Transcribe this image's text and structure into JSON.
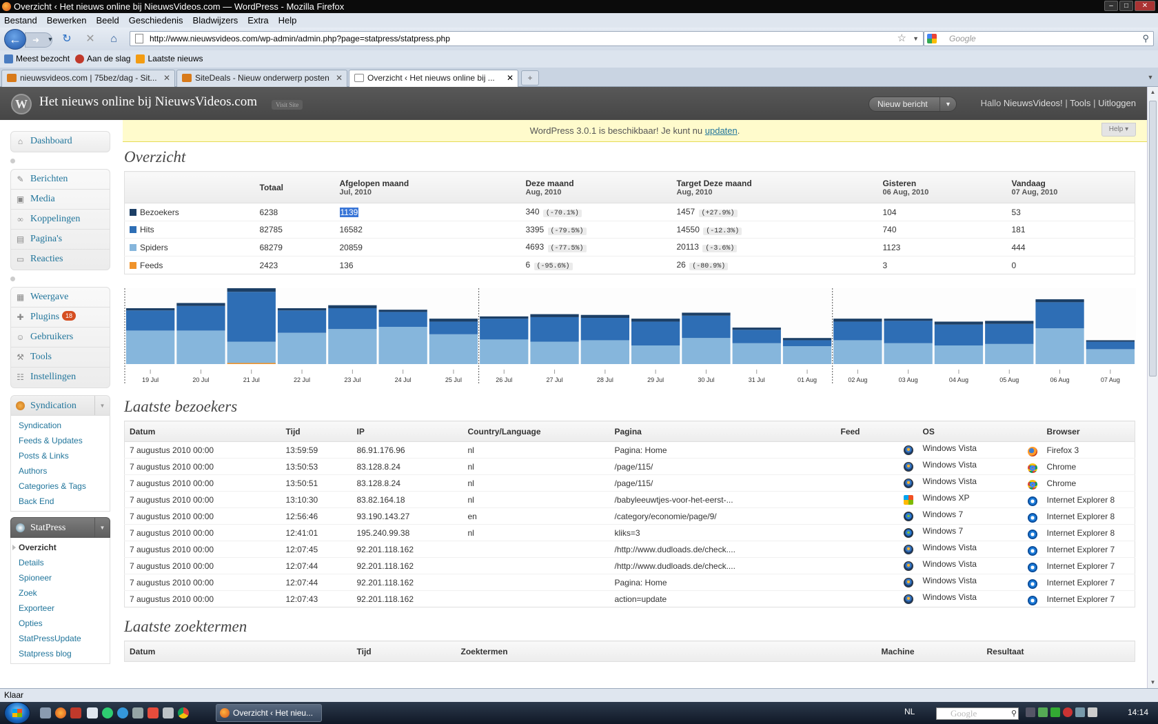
{
  "window": {
    "title": "Overzicht ‹ Het nieuws online bij NieuwsVideos.com — WordPress - Mozilla Firefox"
  },
  "menubar": [
    "Bestand",
    "Bewerken",
    "Beeld",
    "Geschiedenis",
    "Bladwijzers",
    "Extra",
    "Help"
  ],
  "url": "http://www.nieuwsvideos.com/wp-admin/admin.php?page=statpress/statpress.php",
  "search_placeholder": "Google",
  "bookmarks": [
    "Meest bezocht",
    "Aan de slag",
    "Laatste nieuws"
  ],
  "tabs": [
    {
      "label": "nieuwsvideos.com | 75bez/dag - Sit...",
      "active": false
    },
    {
      "label": "SiteDeals - Nieuw onderwerp posten",
      "active": false
    },
    {
      "label": "Overzicht ‹ Het nieuws online bij ...",
      "active": true
    }
  ],
  "wp": {
    "site_title": "Het nieuws online bij NieuwsVideos.com",
    "visit_site": "Visit Site",
    "new_post": "Nieuw bericht",
    "greeting": "Hallo",
    "username": "NieuwsVideos!",
    "tools": "Tools",
    "logout": "Uitloggen",
    "update_text": "WordPress 3.0.1 is beschikbaar! Je kunt nu",
    "update_link": "updaten",
    "update_end": ".",
    "help": "Help"
  },
  "sidebar": {
    "dashboard": "Dashboard",
    "content_items": [
      "Berichten",
      "Media",
      "Koppelingen",
      "Pagina's",
      "Reacties"
    ],
    "admin_items": [
      "Weergave",
      "Plugins",
      "Gebruikers",
      "Tools",
      "Instellingen"
    ],
    "plugins_badge": "18",
    "syndication": {
      "title": "Syndication",
      "items": [
        "Syndication",
        "Feeds & Updates",
        "Posts & Links",
        "Authors",
        "Categories & Tags",
        "Back End"
      ]
    },
    "statpress": {
      "title": "StatPress",
      "items": [
        "Overzicht",
        "Details",
        "Spioneer",
        "Zoek",
        "Exporteer",
        "Opties",
        "StatPressUpdate",
        "Statpress blog"
      ]
    }
  },
  "overview": {
    "heading": "Overzicht",
    "columns": [
      {
        "label": "",
        "sub": ""
      },
      {
        "label": "Totaal",
        "sub": ""
      },
      {
        "label": "Afgelopen maand",
        "sub": "Jul, 2010"
      },
      {
        "label": "Deze maand",
        "sub": "Aug, 2010"
      },
      {
        "label": "Target Deze maand",
        "sub": "Aug, 2010"
      },
      {
        "label": "Gisteren",
        "sub": "06 Aug, 2010"
      },
      {
        "label": "Vandaag",
        "sub": "07 Aug, 2010"
      }
    ],
    "rows": [
      {
        "name": "Bezoekers",
        "color": "#1c3f66",
        "totaal": "6238",
        "afgelopen": "1139",
        "deze": "340",
        "deze_pct": "(-70.1%)",
        "target": "1457",
        "target_pct": "(+27.9%)",
        "gisteren": "104",
        "vandaag": "53"
      },
      {
        "name": "Hits",
        "color": "#2e6eb5",
        "totaal": "82785",
        "afgelopen": "16582",
        "deze": "3395",
        "deze_pct": "(-79.5%)",
        "target": "14550",
        "target_pct": "(-12.3%)",
        "gisteren": "740",
        "vandaag": "181"
      },
      {
        "name": "Spiders",
        "color": "#86b6dc",
        "totaal": "68279",
        "afgelopen": "20859",
        "deze": "4693",
        "deze_pct": "(-77.5%)",
        "target": "20113",
        "target_pct": "(-3.6%)",
        "gisteren": "1123",
        "vandaag": "444"
      },
      {
        "name": "Feeds",
        "color": "#f0932b",
        "totaal": "2423",
        "afgelopen": "136",
        "deze": "6",
        "deze_pct": "(-95.6%)",
        "target": "26",
        "target_pct": "(-80.9%)",
        "gisteren": "3",
        "vandaag": "0"
      }
    ]
  },
  "chart_data": {
    "type": "bar",
    "categories": [
      "19 Jul",
      "20 Jul",
      "21 Jul",
      "22 Jul",
      "23 Jul",
      "24 Jul",
      "25 Jul",
      "26 Jul",
      "27 Jul",
      "28 Jul",
      "29 Jul",
      "30 Jul",
      "31 Jul",
      "01 Aug",
      "02 Aug",
      "03 Aug",
      "04 Aug",
      "05 Aug",
      "06 Aug",
      "07 Aug"
    ],
    "series": [
      {
        "name": "Spiders",
        "color": "#86b6dc",
        "values": [
          45,
          45,
          30,
          42,
          47,
          50,
          40,
          33,
          30,
          32,
          25,
          35,
          28,
          24,
          32,
          28,
          25,
          27,
          48,
          20
        ]
      },
      {
        "name": "Hits",
        "color": "#2e6eb5",
        "values": [
          27,
          33,
          67,
          30,
          28,
          20,
          17,
          28,
          33,
          30,
          32,
          30,
          18,
          8,
          25,
          30,
          28,
          27,
          35,
          10
        ]
      },
      {
        "name": "Bezoekers",
        "color": "#1c3f66",
        "values": [
          3,
          4,
          5,
          3,
          4,
          3,
          4,
          3,
          4,
          4,
          4,
          4,
          3,
          3,
          4,
          3,
          4,
          4,
          4,
          2
        ]
      },
      {
        "name": "Feeds",
        "color": "#f0932b",
        "values": [
          0,
          0,
          1.5,
          0,
          0,
          0,
          0,
          0,
          0,
          0,
          0,
          0,
          0,
          0,
          0,
          0,
          0,
          0,
          0,
          0
        ]
      }
    ],
    "month_dividers_after": [
      "25 Jul",
      "01 Aug"
    ],
    "ylim": [
      0,
      100
    ],
    "grid": false,
    "legend": "none"
  },
  "visitors": {
    "heading": "Laatste bezoekers",
    "columns": [
      "Datum",
      "Tijd",
      "IP",
      "Country/Language",
      "Pagina",
      "Feed",
      "OS",
      "Browser"
    ],
    "rows": [
      {
        "datum": "7 augustus 2010 00:00",
        "tijd": "13:59:59",
        "ip": "86.91.176.96",
        "lang": "nl",
        "pagina": "Pagina: Home",
        "feed": "",
        "os_icon": "windows-vista-icon",
        "os": "Windows Vista",
        "br_icon": "firefox-icon",
        "browser": "Firefox 3"
      },
      {
        "datum": "7 augustus 2010 00:00",
        "tijd": "13:50:53",
        "ip": "83.128.8.24",
        "lang": "nl",
        "pagina": "/page/115/",
        "feed": "",
        "os_icon": "windows-vista-icon",
        "os": "Windows Vista",
        "br_icon": "chrome-icon",
        "browser": "Chrome"
      },
      {
        "datum": "7 augustus 2010 00:00",
        "tijd": "13:50:51",
        "ip": "83.128.8.24",
        "lang": "nl",
        "pagina": "/page/115/",
        "feed": "",
        "os_icon": "windows-vista-icon",
        "os": "Windows Vista",
        "br_icon": "chrome-icon",
        "browser": "Chrome"
      },
      {
        "datum": "7 augustus 2010 00:00",
        "tijd": "13:10:30",
        "ip": "83.82.164.18",
        "lang": "nl",
        "pagina": "/babyleeuwtjes-voor-het-eerst-...",
        "feed": "",
        "os_icon": "windows-xp-icon",
        "os": "Windows XP",
        "br_icon": "ie-icon",
        "browser": "Internet Explorer 8"
      },
      {
        "datum": "7 augustus 2010 00:00",
        "tijd": "12:56:46",
        "ip": "93.190.143.27",
        "lang": "en",
        "pagina": "/category/economie/page/9/",
        "feed": "",
        "os_icon": "windows-7-icon",
        "os": "Windows 7",
        "br_icon": "ie-icon",
        "browser": "Internet Explorer 8"
      },
      {
        "datum": "7 augustus 2010 00:00",
        "tijd": "12:41:01",
        "ip": "195.240.99.38",
        "lang": "nl",
        "pagina": "kliks=3",
        "feed": "",
        "os_icon": "windows-7-icon",
        "os": "Windows 7",
        "br_icon": "ie-icon",
        "browser": "Internet Explorer 8"
      },
      {
        "datum": "7 augustus 2010 00:00",
        "tijd": "12:07:45",
        "ip": "92.201.118.162",
        "lang": "",
        "pagina": "/http://www.dudloads.de/check....",
        "feed": "",
        "os_icon": "windows-vista-icon",
        "os": "Windows Vista",
        "br_icon": "ie-icon",
        "browser": "Internet Explorer 7"
      },
      {
        "datum": "7 augustus 2010 00:00",
        "tijd": "12:07:44",
        "ip": "92.201.118.162",
        "lang": "",
        "pagina": "/http://www.dudloads.de/check....",
        "feed": "",
        "os_icon": "windows-vista-icon",
        "os": "Windows Vista",
        "br_icon": "ie-icon",
        "browser": "Internet Explorer 7"
      },
      {
        "datum": "7 augustus 2010 00:00",
        "tijd": "12:07:44",
        "ip": "92.201.118.162",
        "lang": "",
        "pagina": "Pagina: Home",
        "feed": "",
        "os_icon": "windows-vista-icon",
        "os": "Windows Vista",
        "br_icon": "ie-icon",
        "browser": "Internet Explorer 7"
      },
      {
        "datum": "7 augustus 2010 00:00",
        "tijd": "12:07:43",
        "ip": "92.201.118.162",
        "lang": "",
        "pagina": "action=update",
        "feed": "",
        "os_icon": "windows-vista-icon",
        "os": "Windows Vista",
        "br_icon": "ie-icon",
        "browser": "Internet Explorer 7"
      }
    ]
  },
  "searches": {
    "heading": "Laatste zoektermen",
    "columns": [
      "Datum",
      "Tijd",
      "Zoektermen",
      "Machine",
      "Resultaat"
    ]
  },
  "status": "Klaar",
  "taskbar": {
    "task": "Overzicht ‹ Het nieu...",
    "lang": "NL",
    "search": "Google",
    "clock": "14:14"
  }
}
